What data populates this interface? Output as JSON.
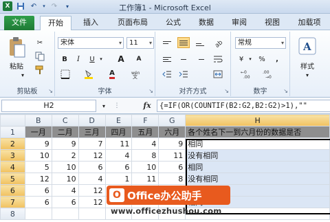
{
  "window": {
    "title": "工作簿1 - Microsoft Excel",
    "qat_icons": [
      "excel-logo-icon",
      "save-icon",
      "undo-icon",
      "redo-icon",
      "customize-icon"
    ]
  },
  "tabs": [
    {
      "label": "文件",
      "name": "tab-file"
    },
    {
      "label": "开始",
      "name": "tab-home",
      "active": true
    },
    {
      "label": "插入",
      "name": "tab-insert"
    },
    {
      "label": "页面布局",
      "name": "tab-page-layout"
    },
    {
      "label": "公式",
      "name": "tab-formulas"
    },
    {
      "label": "数据",
      "name": "tab-data"
    },
    {
      "label": "审阅",
      "name": "tab-review"
    },
    {
      "label": "视图",
      "name": "tab-view"
    },
    {
      "label": "加载项",
      "name": "tab-addins"
    }
  ],
  "ribbon": {
    "clipboard": {
      "label": "剪贴板",
      "paste": "粘贴"
    },
    "font": {
      "label": "字体",
      "name_value": "宋体",
      "size_value": "11",
      "bold": "B",
      "italic": "I",
      "underline": "U",
      "grow": "A",
      "shrink": "A"
    },
    "alignment": {
      "label": "对齐方式"
    },
    "number": {
      "label": "数字",
      "format_value": "常规",
      "currency": "¥",
      "percent": "%",
      "comma": ","
    },
    "styles": {
      "label": "样式",
      "big_button": "样式"
    }
  },
  "formula_bar": {
    "name_box": "H2",
    "fx": "fx",
    "formula": "{=IF(OR(COUNTIF(B2:G2,B2:G2)>1),\"\""
  },
  "sheet": {
    "columns": [
      "",
      "B",
      "C",
      "D",
      "E",
      "F",
      "G",
      "H"
    ],
    "rows": [
      {
        "n": "1",
        "cells": [
          "一月",
          "二月",
          "三月",
          "四月",
          "五月",
          "六月"
        ],
        "h": "各个姓名下一到六月份的数据是否"
      },
      {
        "n": "2",
        "cells": [
          "9",
          "9",
          "7",
          "11",
          "4",
          "9"
        ],
        "h": "相同"
      },
      {
        "n": "3",
        "cells": [
          "10",
          "2",
          "12",
          "4",
          "8",
          "11"
        ],
        "h": "没有相同"
      },
      {
        "n": "4",
        "cells": [
          "5",
          "10",
          "6",
          "6",
          "10",
          "6"
        ],
        "h": "相同"
      },
      {
        "n": "5",
        "cells": [
          "12",
          "10",
          "4",
          "1",
          "11",
          "8"
        ],
        "h": "没有相同"
      },
      {
        "n": "6",
        "cells": [
          "6",
          "4",
          "12",
          "",
          "",
          ""
        ],
        "h": "没有相同"
      },
      {
        "n": "7",
        "cells": [
          "6",
          "6",
          "12",
          "",
          "",
          ""
        ],
        "h": "相同"
      },
      {
        "n": "8",
        "cells": [
          "",
          "",
          "",
          "",
          "",
          ""
        ],
        "h": ""
      }
    ]
  },
  "watermark": {
    "badge": "Office办公助手",
    "url": "www.officezhushou.com"
  },
  "colors": {
    "file_tab": "#1e7a35",
    "ribbon_bg": "#e7eff9",
    "selection": "#dbe6f5",
    "header_row": "#8e8e8e",
    "watermark": "#e85a1e"
  }
}
